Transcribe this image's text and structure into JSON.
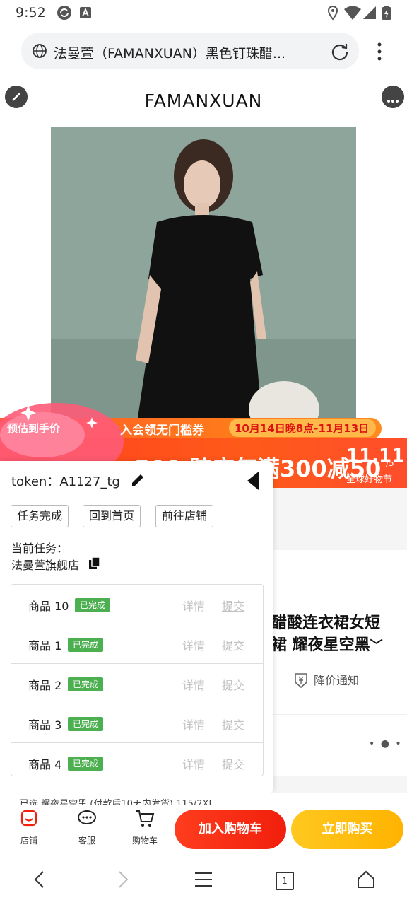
{
  "status_bar": {
    "time": "9:52"
  },
  "browser": {
    "url_title": "法曼萱（FAMANXUAN）黑色钉珠醋..."
  },
  "page": {
    "brand_logo": "FAMANXUAN",
    "promo": {
      "estimate_label": "预估到手价",
      "member_coupon": "入会领无门槛券",
      "date_range": "10月14日晚8点-11月13日",
      "big_text": "500  跨店每满300减50",
      "event_logo": "11.11",
      "event_sub": "全球好物节",
      "slide_counter": "/5"
    },
    "product_title_line1": "醋酸连衣裙女短",
    "product_title_line2": "裙 耀夜星空黑",
    "price_notice": "降价通知",
    "behind_text": "已选  耀夜星空黑  (付款后10天内发货)  115/2XL"
  },
  "panel": {
    "token_label": "token：A1127_tg",
    "buttons": [
      "任务完成",
      "回到首页",
      "前往店铺"
    ],
    "current_task_label": "当前任务：",
    "current_task_value": "法曼萱旗舰店",
    "rows": [
      {
        "name": "商品 10",
        "badge": "已完成",
        "detail": "详情",
        "submit": "提交"
      },
      {
        "name": "商品 1",
        "badge": "已完成",
        "detail": "详情",
        "submit": "提交"
      },
      {
        "name": "商品 2",
        "badge": "已完成",
        "detail": "详情",
        "submit": "提交"
      },
      {
        "name": "商品 3",
        "badge": "已完成",
        "detail": "详情",
        "submit": "提交"
      },
      {
        "name": "商品 4",
        "badge": "已完成",
        "detail": "详情",
        "submit": "提交"
      }
    ]
  },
  "bottom_bar": {
    "store": "店铺",
    "service": "客服",
    "cart": "购物车",
    "add_to_cart": "加入购物车",
    "buy_now": "立即购买"
  },
  "nav_bar": {
    "tab_count": "1"
  },
  "colors": {
    "primary_red": "#f11f0c",
    "buy_yellow": "#ffb300",
    "badge_green": "#4caf50"
  }
}
